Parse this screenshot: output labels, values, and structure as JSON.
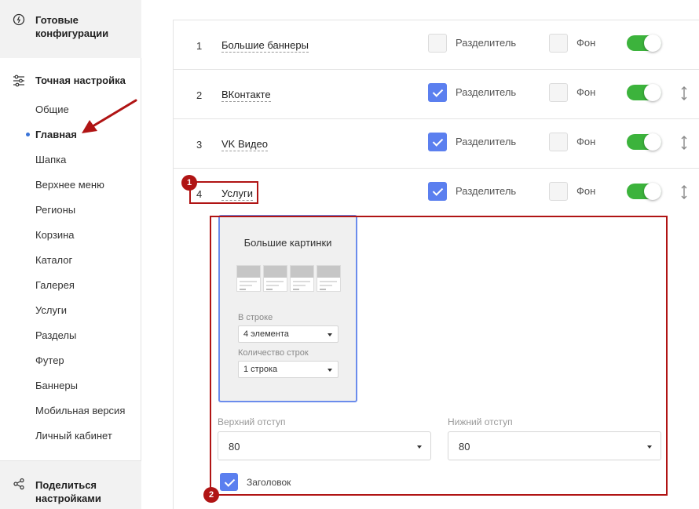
{
  "sidebar": {
    "ready_configs": "Готовые конфигурации",
    "fine_tuning": "Точная настройка",
    "items": [
      "Общие",
      "Главная",
      "Шапка",
      "Верхнее меню",
      "Регионы",
      "Корзина",
      "Каталог",
      "Галерея",
      "Услуги",
      "Разделы",
      "Футер",
      "Баннеры",
      "Мобильная версия",
      "Личный кабинет"
    ],
    "active_item": "Главная",
    "share_settings": "Поделиться настройками"
  },
  "rows": [
    {
      "num": "1",
      "title": "Большие баннеры",
      "divider_label": "Разделитель",
      "divider_checked": false,
      "bg_label": "Фон",
      "bg_checked": false,
      "enabled": true
    },
    {
      "num": "2",
      "title": "ВКонтакте",
      "divider_label": "Разделитель",
      "divider_checked": true,
      "bg_label": "Фон",
      "bg_checked": false,
      "enabled": true
    },
    {
      "num": "3",
      "title": "VK Видео",
      "divider_label": "Разделитель",
      "divider_checked": true,
      "bg_label": "Фон",
      "bg_checked": false,
      "enabled": true
    },
    {
      "num": "4",
      "title": "Услуги",
      "divider_label": "Разделитель",
      "divider_checked": true,
      "bg_label": "Фон",
      "bg_checked": false,
      "enabled": true
    }
  ],
  "badges": {
    "one": "1",
    "two": "2"
  },
  "panel": {
    "card_title": "Большие картинки",
    "per_row_label": "В строке",
    "per_row_value": "4 элемента",
    "rows_count_label": "Количество строк",
    "rows_count_value": "1 строка",
    "top_padding_label": "Верхний отступ",
    "top_padding_value": "80",
    "bottom_padding_label": "Нижний отступ",
    "bottom_padding_value": "80",
    "header_checkbox_label": "Заголовок",
    "header_checked": true
  },
  "colors": {
    "accent": "#5b7fef",
    "toggle_on": "#3cb33c",
    "highlight": "#b01414"
  }
}
